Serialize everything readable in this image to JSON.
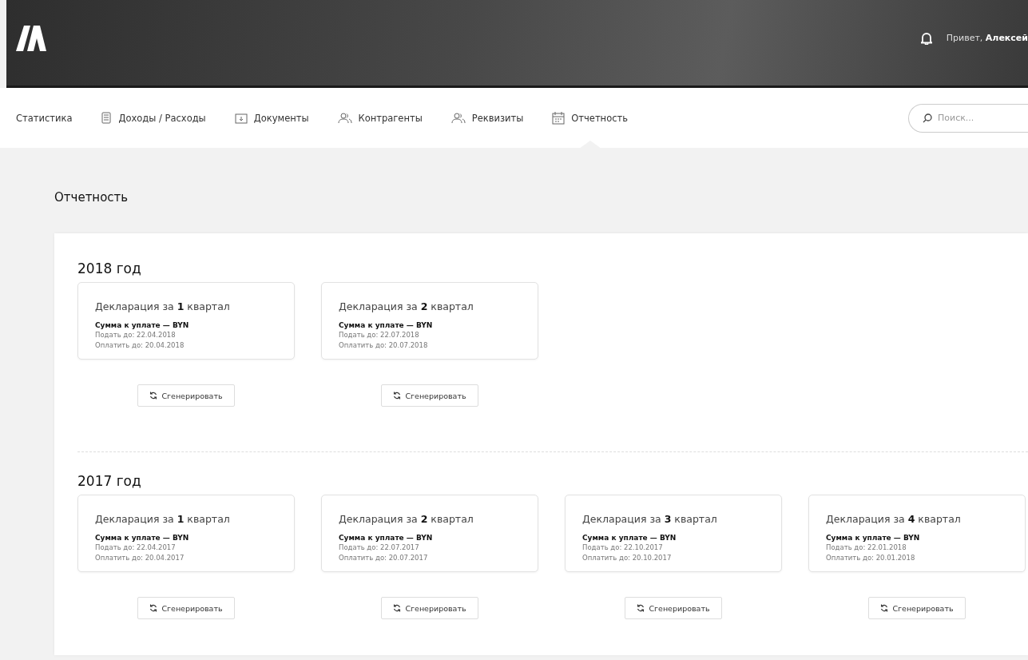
{
  "header": {
    "greeting": "Привет, **Алексей**"
  },
  "nav": {
    "items": [
      {
        "label": "Статистика",
        "kind": "plain",
        "selected": false
      },
      {
        "label": "Доходы / Расходы",
        "kind": "money",
        "selected": false
      },
      {
        "label": "Документы",
        "kind": "documents",
        "selected": false
      },
      {
        "label": "Контрагенты",
        "kind": "people",
        "selected": false
      },
      {
        "label": "Реквизиты",
        "kind": "people",
        "selected": false
      },
      {
        "label": "Отчетность",
        "kind": "calendar",
        "selected": true
      }
    ]
  },
  "search": {
    "placeholder": "Поиск..."
  },
  "page_title": "Отчетность",
  "sections": [
    {
      "year": "2018 год",
      "declarations": [
        {
          "title": "Декларация за **1** квартал",
          "amount": "Сумма к уплате — BYN",
          "submit_by": "Подать до: 22.04.2018",
          "pay_by": "Оплатить до: 20.04.2018",
          "button": "Сгенерировать"
        },
        {
          "title": "Декларация за **2** квартал",
          "amount": "Сумма к уплате — BYN",
          "submit_by": "Подать до: 22.07.2018",
          "pay_by": "Оплатить до: 20.07.2018",
          "button": "Сгенерировать"
        }
      ]
    },
    {
      "year": "2017 год",
      "declarations": [
        {
          "title": "Декларация за **1** квартал",
          "amount": "Сумма к уплате — BYN",
          "submit_by": "Подать до: 22.04.2017",
          "pay_by": "Оплатить до: 20.04.2017",
          "button": "Сгенерировать"
        },
        {
          "title": "Декларация за **2** квартал",
          "amount": "Сумма к уплате — BYN",
          "submit_by": "Подать до: 22.07.2017",
          "pay_by": "Оплатить до: 20.07.2017",
          "button": "Сгенерировать"
        },
        {
          "title": "Декларация за **3** квартал",
          "amount": "Сумма к уплате — BYN",
          "submit_by": "Подать до: 22.10.2017",
          "pay_by": "Оплатить до: 20.10.2017",
          "button": "Сгенерировать"
        },
        {
          "title": "Декларация за **4** квартал",
          "amount": "Сумма к уплате — BYN",
          "submit_by": "Подать до: 22.01.2018",
          "pay_by": "Оплатить до: 20.01.2018",
          "button": "Сгенерировать"
        }
      ]
    }
  ]
}
